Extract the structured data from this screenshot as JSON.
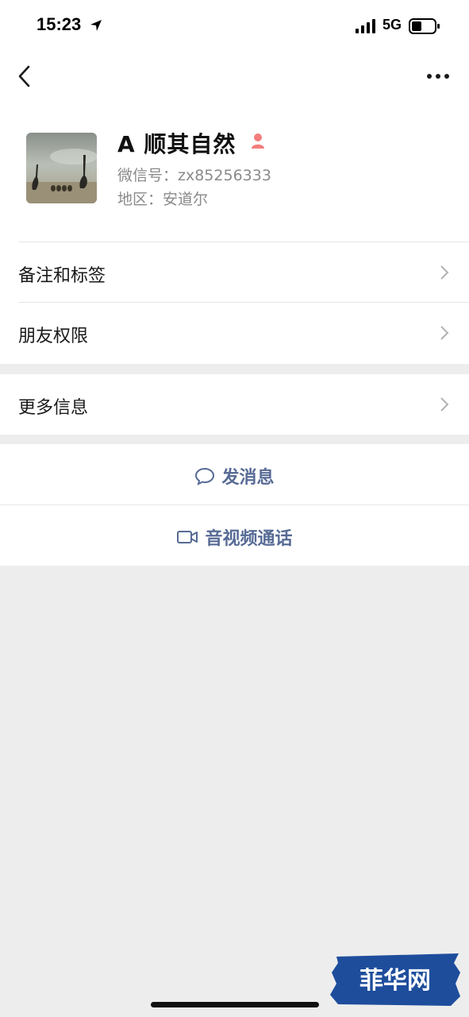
{
  "status_bar": {
    "time": "15:23",
    "network": "5G",
    "icons": [
      "location-arrow-icon",
      "signal-icon",
      "battery-icon"
    ]
  },
  "nav": {
    "back_icon": "chevron-left-icon",
    "more_icon": "more-dots-icon"
  },
  "profile": {
    "nickname": "A 顺其自然",
    "wechat_id": "微信号：zx85256333",
    "region": "地区：安道尔",
    "gender_icon": "female-icon",
    "gender_color": "#f37e7d"
  },
  "rows": [
    {
      "label": "备注和标签"
    },
    {
      "label": "朋友权限"
    },
    {
      "label": "更多信息"
    }
  ],
  "actions": {
    "message": {
      "label": "发消息",
      "icon": "chat-bubble-icon"
    },
    "call": {
      "label": "音视频通话",
      "icon": "video-camera-icon"
    }
  },
  "watermark": {
    "text": "菲华网"
  },
  "colors": {
    "link_blue": "#576b95",
    "background": "#ededed",
    "watermark_blue": "#1e4d9c"
  }
}
